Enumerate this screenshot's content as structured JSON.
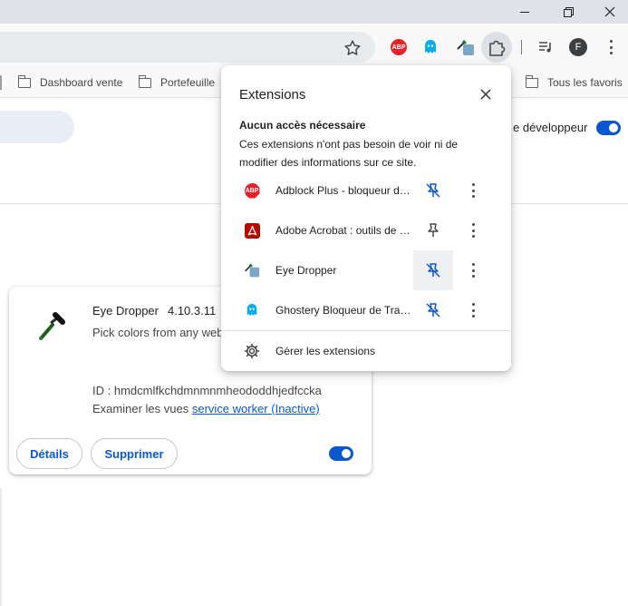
{
  "window": {
    "controls": [
      "minimize-icon",
      "restore-icon",
      "close-icon"
    ]
  },
  "toolbar": {
    "icons": [
      "star-icon",
      "adblock-plus-icon",
      "ghostery-icon",
      "eye-dropper-icon",
      "puzzle-icon",
      "media-control-icon",
      "avatar",
      "kebab-menu-icon"
    ],
    "profile_initial": "F",
    "abp_badge": "ABP"
  },
  "bookmarks": {
    "items": [
      {
        "label": "Dashboard vente"
      },
      {
        "label": "Portefeuille"
      }
    ],
    "all_favorites": "Tous les favoris"
  },
  "page": {
    "developer_mode_label": "e développeur",
    "developer_mode_on": true
  },
  "extension_card": {
    "name": "Eye Dropper",
    "version": "4.10.3.11",
    "description": "Pick colors from any web",
    "id_text": "ID : hmdcmlfkchdmnmnmheododdhjedfccka",
    "views_label": "Examiner les vues",
    "views_link": "service worker (Inactive)",
    "details_button": "Détails",
    "remove_button": "Supprimer",
    "enabled": true
  },
  "extensions_popup": {
    "title": "Extensions",
    "section_title": "Aucun accès nécessaire",
    "section_desc": "Ces extensions n'ont pas besoin de voir ni de modifier des informations sur ce site.",
    "items": [
      {
        "name": "Adblock Plus - bloqueur de pub",
        "icon": "adblock-plus-icon",
        "pinned": true
      },
      {
        "name": "Adobe Acrobat : outils de PDF",
        "icon": "adobe-acrobat-icon",
        "pinned": false
      },
      {
        "name": "Eye Dropper",
        "icon": "eye-dropper-icon",
        "pinned": true
      },
      {
        "name": "Ghostery Bloqueur de Traqueurs",
        "icon": "ghostery-icon",
        "pinned": true
      }
    ],
    "manage_label": "Gérer les extensions"
  },
  "colors": {
    "accent": "#0b57d0",
    "abp_red": "#e3242b",
    "acrobat_red": "#b30b00",
    "ghostery_blue": "#00aef0"
  }
}
